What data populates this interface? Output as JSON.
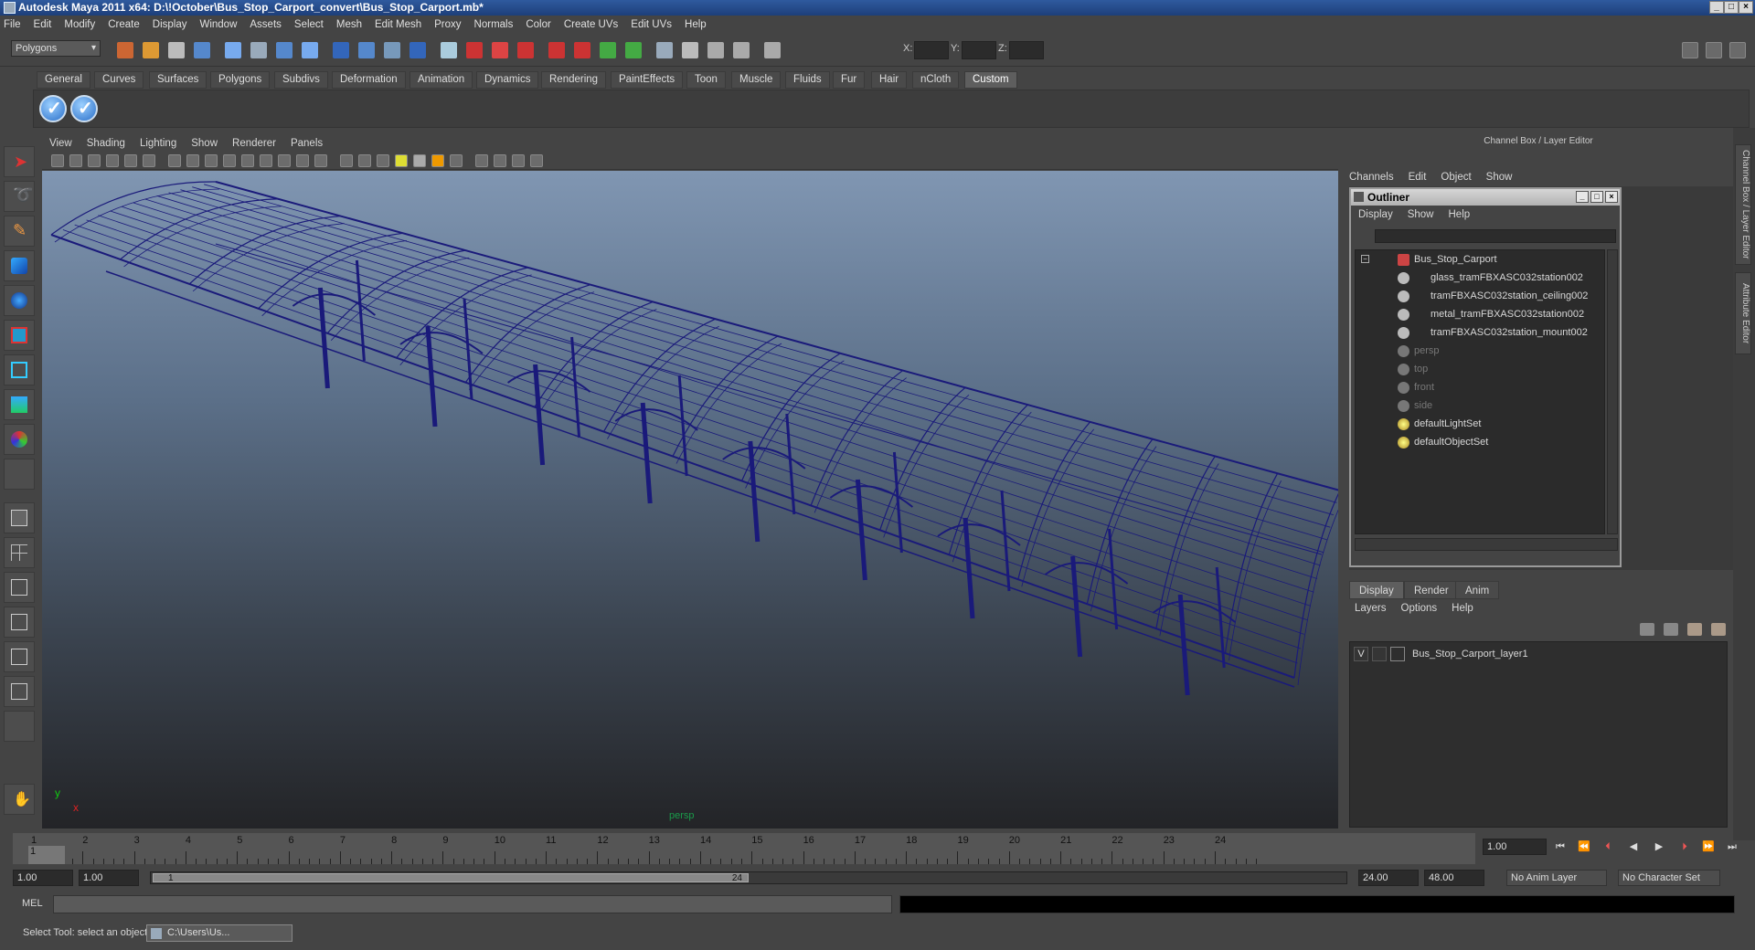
{
  "window": {
    "title": "Autodesk Maya 2011 x64: D:\\!October\\Bus_Stop_Carport_convert\\Bus_Stop_Carport.mb*"
  },
  "menubar": [
    "File",
    "Edit",
    "Modify",
    "Create",
    "Display",
    "Window",
    "Assets",
    "Select",
    "Mesh",
    "Edit Mesh",
    "Proxy",
    "Normals",
    "Color",
    "Create UVs",
    "Edit UVs",
    "Help"
  ],
  "statusline": {
    "mode": "Polygons",
    "x_label": "X:",
    "y_label": "Y:",
    "z_label": "Z:"
  },
  "shelf": {
    "tabs": [
      "General",
      "Curves",
      "Surfaces",
      "Polygons",
      "Subdivs",
      "Deformation",
      "Animation",
      "Dynamics",
      "Rendering",
      "PaintEffects",
      "Toon",
      "Muscle",
      "Fluids",
      "Fur",
      "Hair",
      "nCloth",
      "Custom"
    ],
    "active_tab": "Custom"
  },
  "viewport": {
    "menu": [
      "View",
      "Shading",
      "Lighting",
      "Show",
      "Renderer",
      "Panels"
    ],
    "camera_label": "persp",
    "axis_x": "x",
    "axis_y": "y"
  },
  "channelbox": {
    "header": "Channel Box / Layer Editor",
    "menu": [
      "Channels",
      "Edit",
      "Object",
      "Show"
    ]
  },
  "outliner": {
    "title": "Outliner",
    "menu": [
      "Display",
      "Show",
      "Help"
    ],
    "items": [
      {
        "label": "Bus_Stop_Carport"
      },
      {
        "label": "glass_tramFBXASC032station002"
      },
      {
        "label": "tramFBXASC032station_ceiling002"
      },
      {
        "label": "metal_tramFBXASC032station002"
      },
      {
        "label": "tramFBXASC032station_mount002"
      },
      {
        "label": "persp"
      },
      {
        "label": "top"
      },
      {
        "label": "front"
      },
      {
        "label": "side"
      },
      {
        "label": "defaultLightSet"
      },
      {
        "label": "defaultObjectSet"
      }
    ]
  },
  "layers": {
    "tabs": [
      "Display",
      "Render",
      "Anim"
    ],
    "menu": [
      "Layers",
      "Options",
      "Help"
    ],
    "rows": [
      {
        "visible": "V",
        "name": "Bus_Stop_Carport_layer1"
      }
    ]
  },
  "right_tabs": [
    "Channel Box / Layer Editor",
    "Attribute Editor"
  ],
  "timeline": {
    "ticks": [
      "1",
      "2",
      "3",
      "4",
      "5",
      "6",
      "7",
      "8",
      "9",
      "10",
      "11",
      "12",
      "13",
      "14",
      "15",
      "16",
      "17",
      "18",
      "19",
      "20",
      "21",
      "22",
      "23",
      "24"
    ],
    "current_frame": "1.00",
    "current_marker": "1"
  },
  "range": {
    "start": "1.00",
    "inner_start": "1.00",
    "slider_start": "1",
    "slider_end": "24",
    "inner_end": "24.00",
    "end": "48.00",
    "anim_layer": "No Anim Layer",
    "character_set": "No Character Set"
  },
  "cmdline": {
    "label": "MEL"
  },
  "helpline": {
    "text": "Select Tool: select an object",
    "task": "C:\\Users\\Us..."
  }
}
